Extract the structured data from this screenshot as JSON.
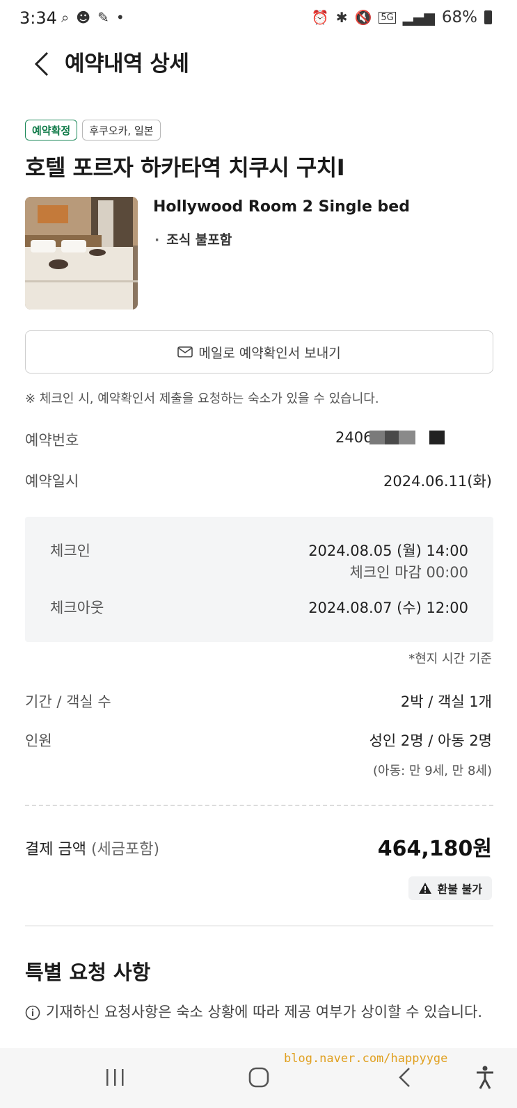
{
  "status_bar": {
    "time": "3:34",
    "battery": "68%",
    "network": "5G"
  },
  "header": {
    "title": "예약내역 상세"
  },
  "booking": {
    "status_badge": "예약확정",
    "location_badge": "후쿠오카, 일본",
    "hotel_name": "호텔 포르자 하카타역 치쿠시 구치I",
    "room_name": "Hollywood Room 2 Single bed",
    "room_option": "조식 불포함"
  },
  "email_button": {
    "label": "메일로 예약확인서 보내기"
  },
  "notice": "※ 체크인 시, 예약확인서 제출을 요청하는 숙소가 있을 수 있습니다.",
  "details": {
    "reservation_number_label": "예약번호",
    "reservation_number_visible": "2406",
    "reservation_date_label": "예약일시",
    "reservation_date": "2024.06.11(화)"
  },
  "check": {
    "checkin_label": "체크인",
    "checkin_value": "2024.08.05 (월) 14:00",
    "checkin_deadline": "체크인 마감 00:00",
    "checkout_label": "체크아웃",
    "checkout_value": "2024.08.07 (수) 12:00",
    "local_time_note": "*현지 시간 기준"
  },
  "stay": {
    "period_label": "기간 / 객실 수",
    "period_value": "2박 / 객실 1개",
    "guests_label": "인원",
    "guests_value": "성인 2명 / 아동 2명",
    "child_ages": "(아동: 만 9세, 만 8세)"
  },
  "payment": {
    "label": "결제 금액",
    "tax_note": "(세금포함)",
    "amount": "464,180원",
    "refund_label": "환불 불가"
  },
  "special_requests": {
    "title": "특별 요청 사항",
    "note": "기재하신 요청사항은 숙소 상황에 따라 제공 여부가 상이할 수 있습니다."
  },
  "watermark": "blog.naver.com/happyyge",
  "colors": {
    "accent_green": "#1f8a5b",
    "box_bg": "#f4f5f6"
  }
}
